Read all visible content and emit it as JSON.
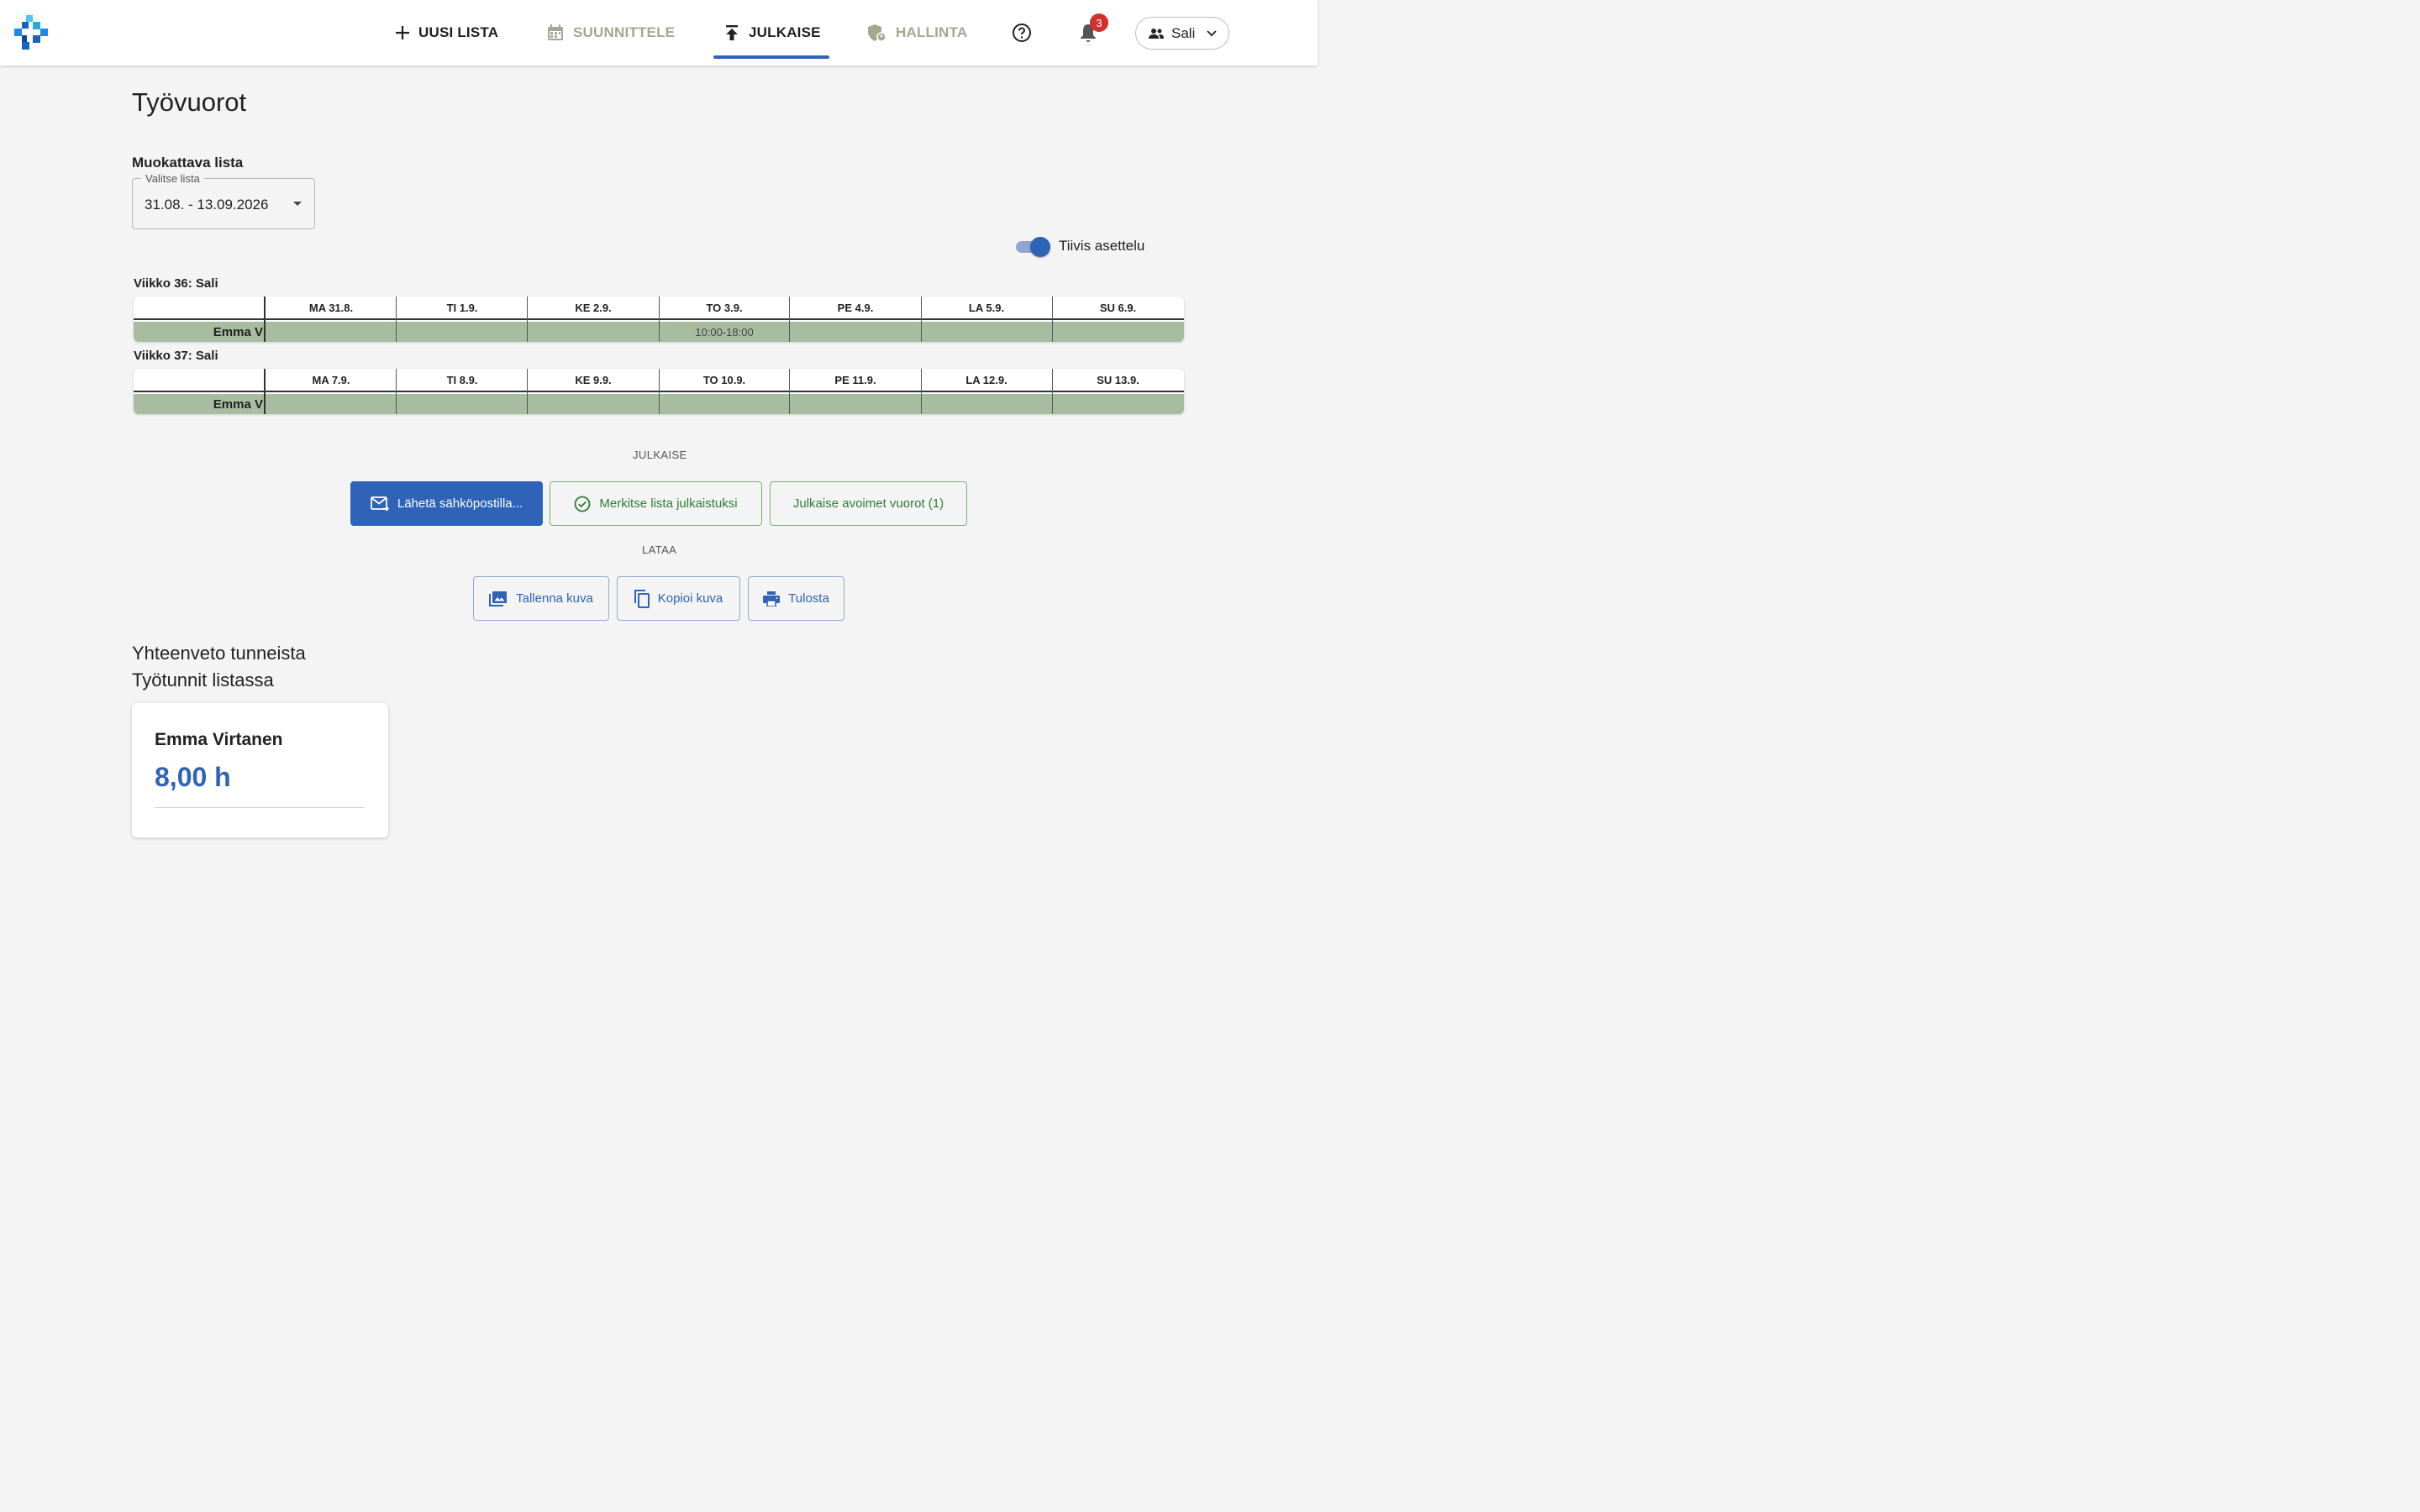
{
  "nav": {
    "new_list": "UUSI LISTA",
    "plan": "SUUNNITTELE",
    "publish": "JULKAISE",
    "admin": "HALLINTA",
    "notifications_count": "3",
    "user_label": "Sali"
  },
  "page": {
    "title": "Työvuorot",
    "editable_list_label": "Muokattava lista",
    "select_legend": "Valitse lista",
    "select_value": "31.08. - 13.09.2026",
    "compact_toggle_label": "Tiivis asettelu",
    "compact_toggle_on": true
  },
  "weeks": [
    {
      "title": "Viikko 36: Sali",
      "days": [
        "MA 31.8.",
        "TI 1.9.",
        "KE 2.9.",
        "TO 3.9.",
        "PE 4.9.",
        "LA 5.9.",
        "SU 6.9."
      ],
      "rows": [
        {
          "name": "Emma V",
          "shifts": [
            "",
            "",
            "",
            "10:00-18:00",
            "",
            "",
            ""
          ]
        }
      ]
    },
    {
      "title": "Viikko 37: Sali",
      "days": [
        "MA 7.9.",
        "TI 8.9.",
        "KE 9.9.",
        "TO 10.9.",
        "PE 11.9.",
        "LA 12.9.",
        "SU 13.9."
      ],
      "rows": [
        {
          "name": "Emma V",
          "shifts": [
            "",
            "",
            "",
            "",
            "",
            "",
            ""
          ]
        }
      ]
    }
  ],
  "publish": {
    "caption": "JULKAISE",
    "send_email": "Lähetä sähköpostilla...",
    "mark_published": "Merkitse lista julkaistuksi",
    "publish_open": "Julkaise avoimet vuorot (1)"
  },
  "download": {
    "caption": "LATAA",
    "save_image": "Tallenna kuva",
    "copy_image": "Kopioi kuva",
    "print": "Tulosta"
  },
  "summary": {
    "title": "Yhteenveto tunneista",
    "subtitle": "Työtunnit listassa",
    "people": [
      {
        "name": "Emma Virtanen",
        "hours": "8,00 h"
      }
    ]
  },
  "colors": {
    "accent": "#2e63b8",
    "success": "#2e7d32",
    "row_fill": "#a8bc9f",
    "badge": "#d32f2f"
  }
}
